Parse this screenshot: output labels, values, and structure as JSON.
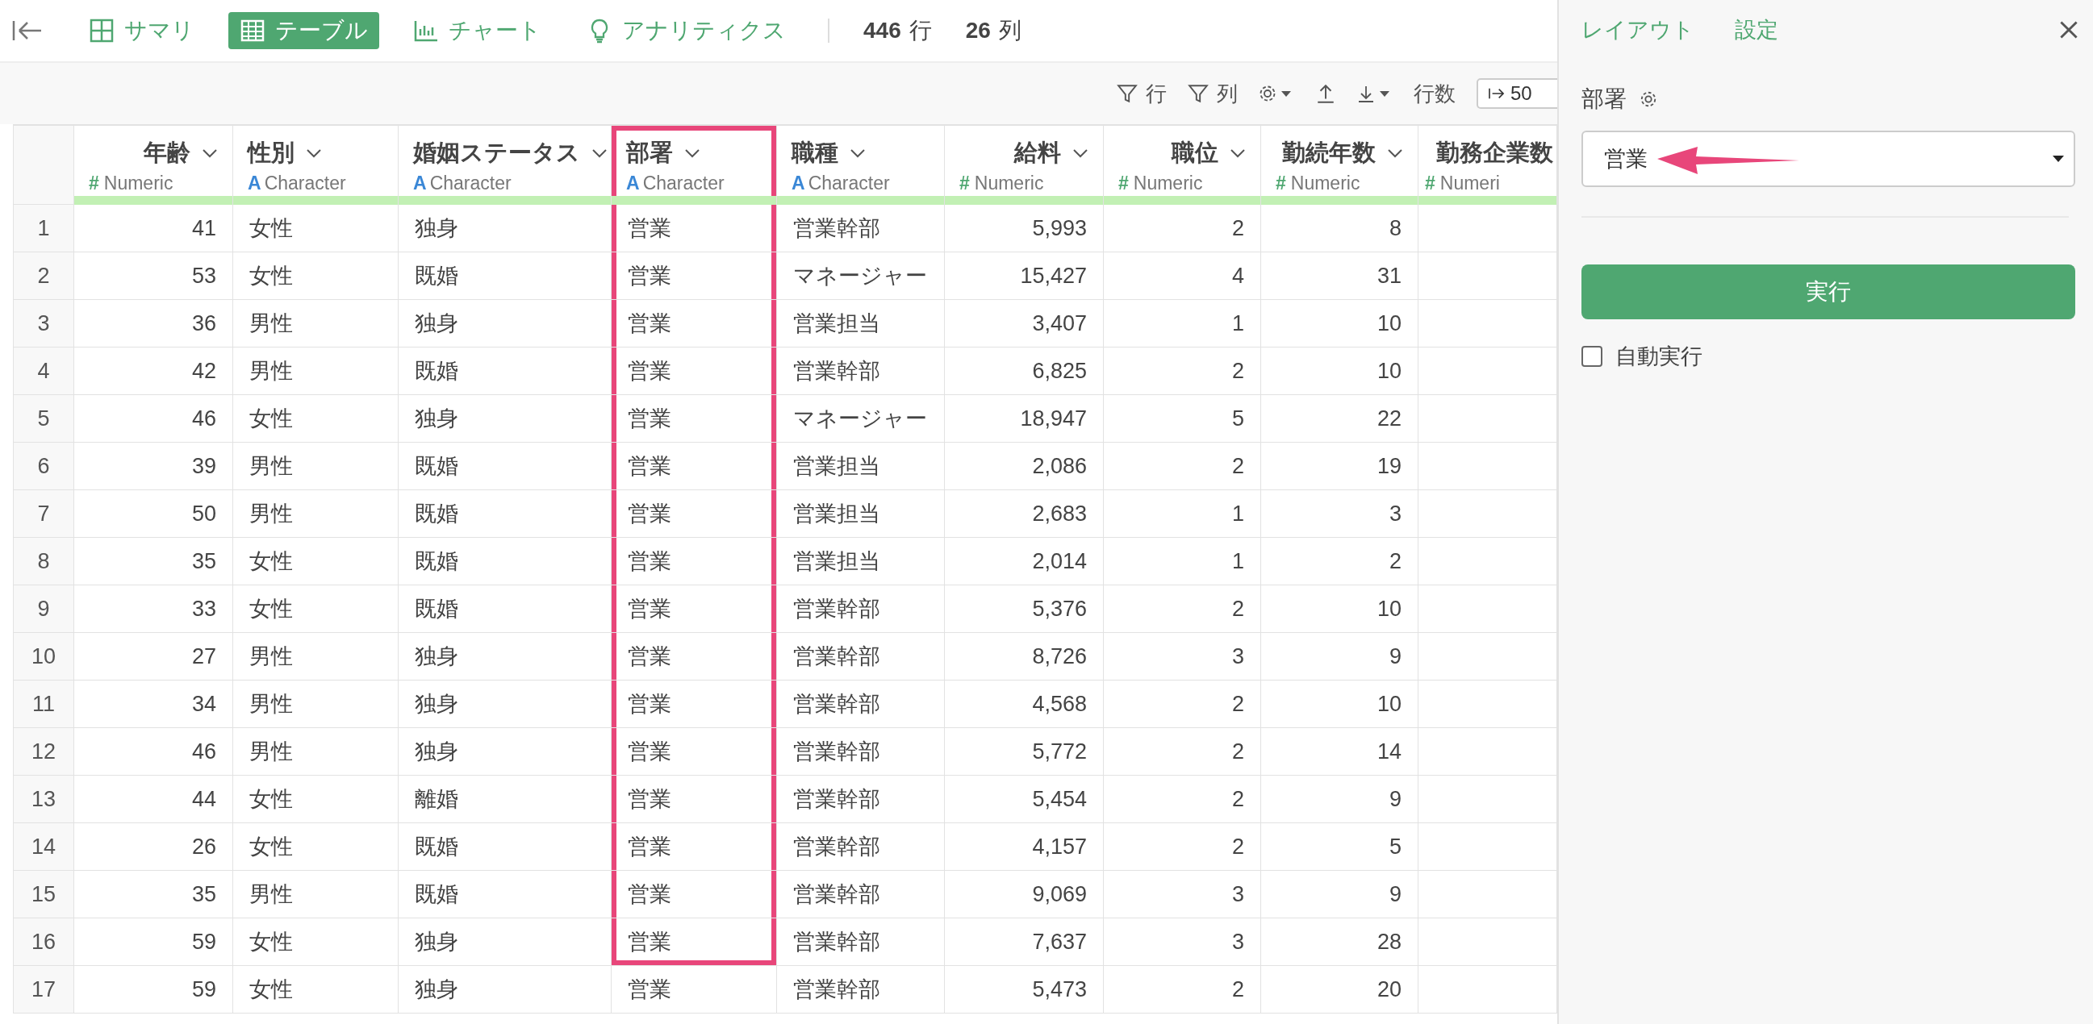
{
  "view_tabs": [
    {
      "label": "サマリ",
      "selected": false
    },
    {
      "label": "テーブル",
      "selected": true
    },
    {
      "label": "チャート",
      "selected": false
    },
    {
      "label": "アナリティクス",
      "selected": false
    }
  ],
  "counts": [
    {
      "value": "446",
      "unit": "行"
    },
    {
      "value": "26",
      "unit": "列"
    }
  ],
  "toolbar": {
    "filter_rows": "行",
    "filter_columns": "列",
    "rows_label": "行数",
    "rows_value": "50"
  },
  "table": {
    "columns": [
      {
        "name": "年齢",
        "kind": "numeric",
        "type_icon": "#",
        "type_label": "Numeric",
        "highlighted": false
      },
      {
        "name": "性別",
        "kind": "character",
        "type_icon": "A",
        "type_label": "Character",
        "highlighted": false
      },
      {
        "name": "婚姻ステータス",
        "kind": "character",
        "type_icon": "A",
        "type_label": "Character",
        "highlighted": false
      },
      {
        "name": "部署",
        "kind": "character",
        "type_icon": "A",
        "type_label": "Character",
        "highlighted": true
      },
      {
        "name": "職種",
        "kind": "character",
        "type_icon": "A",
        "type_label": "Character",
        "highlighted": false
      },
      {
        "name": "給料",
        "kind": "numeric",
        "type_icon": "#",
        "type_label": "Numeric",
        "highlighted": false
      },
      {
        "name": "職位",
        "kind": "numeric",
        "type_icon": "#",
        "type_label": "Numeric",
        "highlighted": false
      },
      {
        "name": "勤続年数",
        "kind": "numeric",
        "type_icon": "#",
        "type_label": "Numeric",
        "highlighted": false
      },
      {
        "name": "勤務企業数",
        "kind": "numeric",
        "type_icon": "#",
        "type_label": "Numeri",
        "highlighted": false
      }
    ],
    "rows": [
      {
        "number": "1",
        "cells": [
          "41",
          "女性",
          "独身",
          "営業",
          "営業幹部",
          "5,993",
          "2",
          "8"
        ],
        "highlighted": true
      },
      {
        "number": "2",
        "cells": [
          "53",
          "女性",
          "既婚",
          "営業",
          "マネージャー",
          "15,427",
          "4",
          "31"
        ],
        "highlighted": true
      },
      {
        "number": "3",
        "cells": [
          "36",
          "男性",
          "独身",
          "営業",
          "営業担当",
          "3,407",
          "1",
          "10"
        ],
        "highlighted": true
      },
      {
        "number": "4",
        "cells": [
          "42",
          "男性",
          "既婚",
          "営業",
          "営業幹部",
          "6,825",
          "2",
          "10"
        ],
        "highlighted": true
      },
      {
        "number": "5",
        "cells": [
          "46",
          "女性",
          "独身",
          "営業",
          "マネージャー",
          "18,947",
          "5",
          "22"
        ],
        "highlighted": true
      },
      {
        "number": "6",
        "cells": [
          "39",
          "男性",
          "既婚",
          "営業",
          "営業担当",
          "2,086",
          "2",
          "19"
        ],
        "highlighted": true
      },
      {
        "number": "7",
        "cells": [
          "50",
          "男性",
          "既婚",
          "営業",
          "営業担当",
          "2,683",
          "1",
          "3"
        ],
        "highlighted": true
      },
      {
        "number": "8",
        "cells": [
          "35",
          "女性",
          "既婚",
          "営業",
          "営業担当",
          "2,014",
          "1",
          "2"
        ],
        "highlighted": true
      },
      {
        "number": "9",
        "cells": [
          "33",
          "女性",
          "既婚",
          "営業",
          "営業幹部",
          "5,376",
          "2",
          "10"
        ],
        "highlighted": true
      },
      {
        "number": "10",
        "cells": [
          "27",
          "男性",
          "独身",
          "営業",
          "営業幹部",
          "8,726",
          "3",
          "9"
        ],
        "highlighted": true
      },
      {
        "number": "11",
        "cells": [
          "34",
          "男性",
          "独身",
          "営業",
          "営業幹部",
          "4,568",
          "2",
          "10"
        ],
        "highlighted": true
      },
      {
        "number": "12",
        "cells": [
          "46",
          "男性",
          "独身",
          "営業",
          "営業幹部",
          "5,772",
          "2",
          "14"
        ],
        "highlighted": true
      },
      {
        "number": "13",
        "cells": [
          "44",
          "女性",
          "離婚",
          "営業",
          "営業幹部",
          "5,454",
          "2",
          "9"
        ],
        "highlighted": true
      },
      {
        "number": "14",
        "cells": [
          "26",
          "女性",
          "既婚",
          "営業",
          "営業幹部",
          "4,157",
          "2",
          "5"
        ],
        "highlighted": true
      },
      {
        "number": "15",
        "cells": [
          "35",
          "男性",
          "既婚",
          "営業",
          "営業幹部",
          "9,069",
          "3",
          "9"
        ],
        "highlighted": true
      },
      {
        "number": "16",
        "cells": [
          "59",
          "女性",
          "独身",
          "営業",
          "営業幹部",
          "7,637",
          "3",
          "28"
        ],
        "highlighted": true
      },
      {
        "number": "17",
        "cells": [
          "59",
          "女性",
          "独身",
          "営業",
          "営業幹部",
          "5,473",
          "2",
          "20"
        ],
        "highlighted": false
      }
    ]
  },
  "panel": {
    "tabs": [
      {
        "label": "レイアウト"
      },
      {
        "label": "設定"
      }
    ],
    "field_label": "部署",
    "field_value": "営業",
    "run_button": "実行",
    "auto_run": {
      "label": "自動実行",
      "checked": false
    }
  }
}
